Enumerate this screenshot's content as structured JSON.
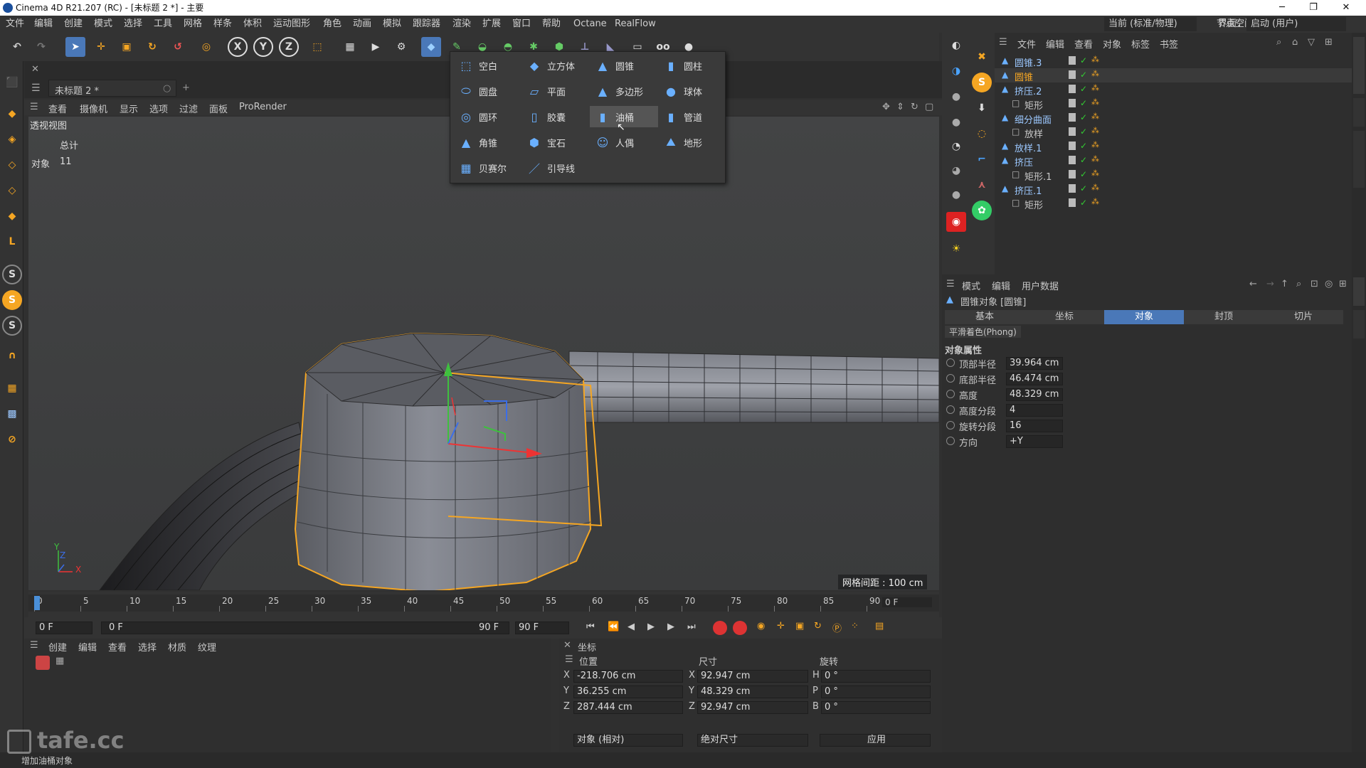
{
  "window": {
    "title": "Cinema 4D R21.207 (RC) - [未标题 2 *] - 主要",
    "minimize": "─",
    "maximize": "❐",
    "close": "✕"
  },
  "menubar": {
    "items": [
      "文件",
      "编辑",
      "创建",
      "模式",
      "选择",
      "工具",
      "网格",
      "样条",
      "体积",
      "运动图形",
      "角色",
      "动画",
      "模拟",
      "跟踪器",
      "渲染",
      "扩展",
      "窗口",
      "帮助",
      "Octane",
      "RealFlow"
    ],
    "node_space_label": "节点空间：",
    "node_space_value": "当前 (标准/物理)",
    "layout_label": "界面：",
    "layout_value": "启动 (用户)"
  },
  "document": {
    "tab": "未标题 2 *",
    "plus": "+"
  },
  "viewport": {
    "menu": [
      "查看",
      "摄像机",
      "显示",
      "选项",
      "过滤",
      "面板",
      "ProRender"
    ],
    "name": "透视视图",
    "stats_total": "总计",
    "stats_objects_label": "对象",
    "stats_objects_value": "11",
    "grid_spacing": "网格间距 : 100 cm",
    "axis_y": "Y",
    "axis_z": "Z",
    "axis_x": "X"
  },
  "dropdown": {
    "items": [
      {
        "label": "空白",
        "icon": "null-icon"
      },
      {
        "label": "立方体",
        "icon": "cube-icon"
      },
      {
        "label": "圆锥",
        "icon": "cone-icon"
      },
      {
        "label": "圆柱",
        "icon": "cylinder-icon"
      },
      {
        "label": "圆盘",
        "icon": "disc-icon"
      },
      {
        "label": "平面",
        "icon": "plane-icon"
      },
      {
        "label": "多边形",
        "icon": "polygon-icon"
      },
      {
        "label": "球体",
        "icon": "sphere-icon"
      },
      {
        "label": "圆环",
        "icon": "torus-icon"
      },
      {
        "label": "胶囊",
        "icon": "capsule-icon"
      },
      {
        "label": "油桶",
        "icon": "oil-tank-icon"
      },
      {
        "label": "管道",
        "icon": "tube-icon"
      },
      {
        "label": "角锥",
        "icon": "pyramid-icon"
      },
      {
        "label": "宝石",
        "icon": "platonic-icon"
      },
      {
        "label": "人偶",
        "icon": "figure-icon"
      },
      {
        "label": "地形",
        "icon": "landscape-icon"
      },
      {
        "label": "贝赛尔",
        "icon": "bezier-icon"
      },
      {
        "label": "引导线",
        "icon": "guide-icon"
      }
    ],
    "highlighted": "油桶"
  },
  "timeline": {
    "ticks": [
      "0",
      "5",
      "10",
      "15",
      "20",
      "25",
      "30",
      "35",
      "40",
      "45",
      "50",
      "55",
      "60",
      "65",
      "70",
      "75",
      "80",
      "85",
      "90"
    ],
    "current_frame": "0 F"
  },
  "playback": {
    "start": "0 F",
    "current": "0 F",
    "end_a": "90 F",
    "end_b": "90 F"
  },
  "material": {
    "menu": [
      "创建",
      "编辑",
      "查看",
      "选择",
      "材质",
      "纹理"
    ]
  },
  "coordinates": {
    "title": "坐标",
    "col_position": "位置",
    "col_size": "尺寸",
    "col_rotation": "旋转",
    "rows": [
      {
        "axis": "X",
        "pos": "-218.706 cm",
        "size_axis": "X",
        "size": "92.947 cm",
        "rot_axis": "H",
        "rot": "0 °"
      },
      {
        "axis": "Y",
        "pos": "36.255 cm",
        "size_axis": "Y",
        "size": "48.329 cm",
        "rot_axis": "P",
        "rot": "0 °"
      },
      {
        "axis": "Z",
        "pos": "287.444 cm",
        "size_axis": "Z",
        "size": "92.947 cm",
        "rot_axis": "B",
        "rot": "0 °"
      }
    ],
    "mode": "对象 (相对)",
    "size_mode": "绝对尺寸",
    "apply": "应用"
  },
  "objects": {
    "menu": [
      "文件",
      "编辑",
      "查看",
      "对象",
      "标签",
      "书签"
    ],
    "tree": [
      {
        "name": "圆锥.3",
        "indent": 0,
        "color": "#9cc8ff"
      },
      {
        "name": "圆锥",
        "indent": 0,
        "color": "#f5a623"
      },
      {
        "name": "挤压.2",
        "indent": 0,
        "color": "#9cc8ff"
      },
      {
        "name": "矩形",
        "indent": 1,
        "color": "#c8c8c8"
      },
      {
        "name": "细分曲面",
        "indent": 0,
        "color": "#9cc8ff"
      },
      {
        "name": "放样",
        "indent": 1,
        "color": "#c8c8c8"
      },
      {
        "name": "放样.1",
        "indent": 0,
        "color": "#9cc8ff"
      },
      {
        "name": "挤压",
        "indent": 0,
        "color": "#9cc8ff"
      },
      {
        "name": "矩形.1",
        "indent": 1,
        "color": "#c8c8c8"
      },
      {
        "name": "挤压.1",
        "indent": 0,
        "color": "#9cc8ff"
      },
      {
        "name": "矩形",
        "indent": 1,
        "color": "#c8c8c8"
      }
    ]
  },
  "attributes": {
    "menu": [
      "模式",
      "编辑",
      "用户数据"
    ],
    "object_title": "圆锥对象 [圆锥]",
    "tabs": [
      "基本",
      "坐标",
      "对象",
      "封顶",
      "切片"
    ],
    "active_tab": "对象",
    "phong": "平滑着色(Phong)",
    "section": "对象属性",
    "props": [
      {
        "label": "顶部半径",
        "value": "39.964 cm"
      },
      {
        "label": "底部半径",
        "value": "46.474 cm"
      },
      {
        "label": "高度",
        "value": "48.329 cm"
      },
      {
        "label": "高度分段",
        "value": "4"
      },
      {
        "label": "旋转分段",
        "value": "16"
      },
      {
        "label": "方向",
        "value": "+Y"
      }
    ]
  },
  "status": {
    "text": "增加油桶对象",
    "watermark": "tafe.cc"
  },
  "colors": {
    "accent": "#4a90d9",
    "selection": "#f5a623",
    "active_tab": "#4a78b8"
  }
}
